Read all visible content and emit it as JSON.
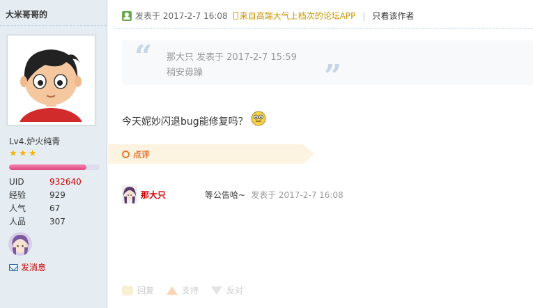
{
  "sidebar": {
    "username": "大米哥哥的",
    "level": "Lv4.炉火纯青",
    "stars": [
      "★",
      "★",
      "★"
    ],
    "exp_fraction": 0.85,
    "stats": [
      {
        "key": "UID",
        "value": "932640"
      },
      {
        "key": "经验",
        "value": "929"
      },
      {
        "key": "人气",
        "value": "67"
      },
      {
        "key": "人品",
        "value": "307"
      }
    ],
    "send_message": "发消息"
  },
  "post": {
    "posted_label": "发表于 2017-2-7 16:08",
    "app_link": "来自高端大气上档次的论坛APP",
    "separator": "|",
    "author_only": "只看该作者",
    "quote": {
      "header": "那大只 发表于 2017-2-7 15:59",
      "body": "稍安毋躁",
      "left_mark": "“",
      "right_mark": "”"
    },
    "content": "今天妮妙闪退bug能修复吗？"
  },
  "comments": {
    "label": "点评",
    "items": [
      {
        "author": "那大只",
        "text": "等公告哈~",
        "time": "发表于 2017-2-7 16:08"
      }
    ]
  },
  "actions": {
    "reply": "回复",
    "support": "支持",
    "oppose": "反对"
  },
  "colors": {
    "sidebar_bg": "#e5edf2",
    "uid_red": "#cc0000",
    "comment_accent": "#e07a3a",
    "app_link": "#c89400"
  }
}
